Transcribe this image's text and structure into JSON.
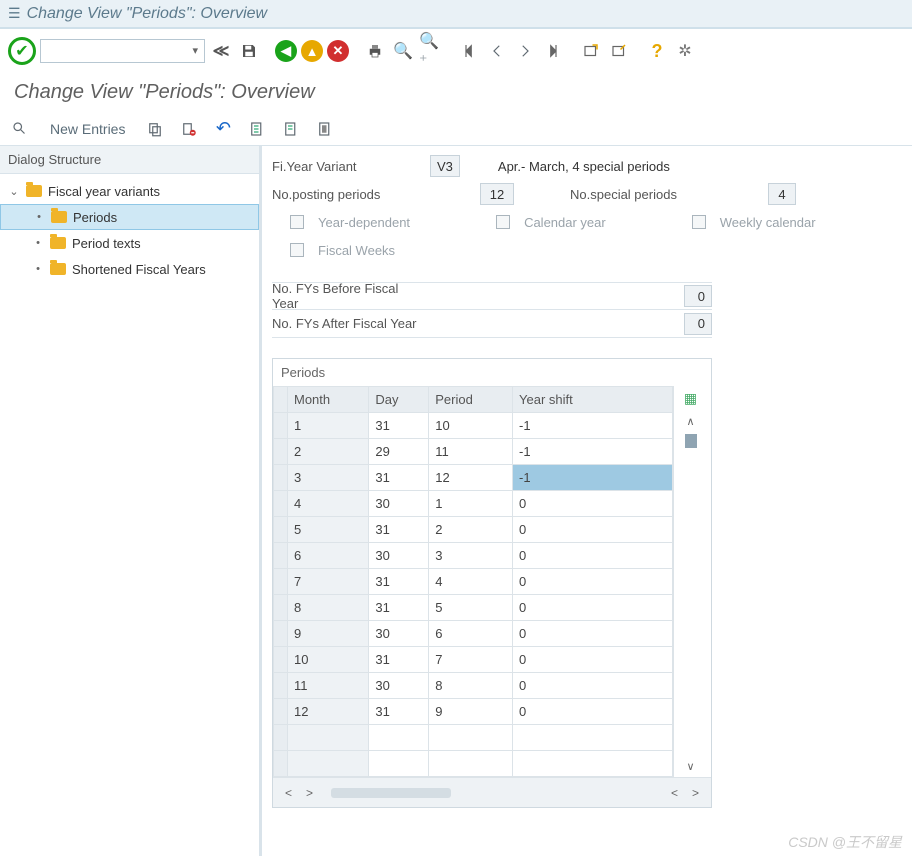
{
  "window": {
    "title": "Change View \"Periods\": Overview"
  },
  "subheader": "Change View \"Periods\": Overview",
  "apptoolbar": {
    "new_entries": "New Entries"
  },
  "sidebar": {
    "header": "Dialog Structure",
    "root": "Fiscal year variants",
    "items": [
      {
        "label": "Periods",
        "selected": true
      },
      {
        "label": "Period texts"
      },
      {
        "label": "Shortened Fiscal Years"
      }
    ]
  },
  "fields": {
    "fi_year_variant_label": "Fi.Year Variant",
    "fi_year_variant_value": "V3",
    "fi_year_variant_desc": "Apr.- March, 4 special periods",
    "no_posting_label": "No.posting periods",
    "no_posting_value": "12",
    "no_special_label": "No.special periods",
    "no_special_value": "4",
    "year_dependent": "Year-dependent",
    "calendar_year": "Calendar year",
    "weekly_calendar": "Weekly calendar",
    "fiscal_weeks": "Fiscal Weeks",
    "fys_before_label": "No. FYs Before Fiscal Year",
    "fys_before_value": "0",
    "fys_after_label": "No. FYs After Fiscal Year",
    "fys_after_value": "0"
  },
  "table": {
    "title": "Periods",
    "columns": [
      "Month",
      "Day",
      "Period",
      "Year shift"
    ],
    "rows": [
      {
        "month": "1",
        "day": "31",
        "period": "10",
        "shift": "-1"
      },
      {
        "month": "2",
        "day": "29",
        "period": "11",
        "shift": "-1"
      },
      {
        "month": "3",
        "day": "31",
        "period": "12",
        "shift": "-1",
        "shift_sel": true
      },
      {
        "month": "4",
        "day": "30",
        "period": "1",
        "shift": "0"
      },
      {
        "month": "5",
        "day": "31",
        "period": "2",
        "shift": "0"
      },
      {
        "month": "6",
        "day": "30",
        "period": "3",
        "shift": "0"
      },
      {
        "month": "7",
        "day": "31",
        "period": "4",
        "shift": "0"
      },
      {
        "month": "8",
        "day": "31",
        "period": "5",
        "shift": "0"
      },
      {
        "month": "9",
        "day": "30",
        "period": "6",
        "shift": "0"
      },
      {
        "month": "10",
        "day": "31",
        "period": "7",
        "shift": "0"
      },
      {
        "month": "11",
        "day": "30",
        "period": "8",
        "shift": "0"
      },
      {
        "month": "12",
        "day": "31",
        "period": "9",
        "shift": "0"
      }
    ],
    "empty_rows": 2
  },
  "watermark": "CSDN @王不留星"
}
